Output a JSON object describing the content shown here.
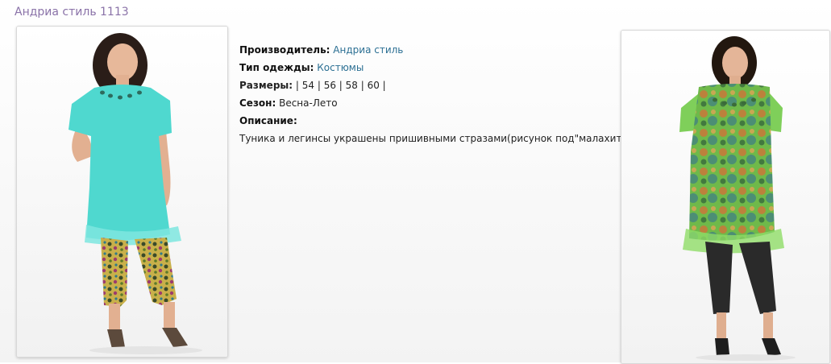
{
  "page": {
    "title": "Андриа стиль 1113"
  },
  "product": {
    "manufacturer": {
      "label": "Производитель:",
      "value": "Андриа стиль"
    },
    "clothing_type": {
      "label": "Тип одежды:",
      "value": "Костюмы"
    },
    "sizes": {
      "label": "Размеры:",
      "value": "| 54 | 56 | 58 | 60 |"
    },
    "season": {
      "label": "Сезон:",
      "value": "Весна-Лето"
    },
    "description": {
      "label": "Описание:",
      "text": "Туника и легинсы украшены пришивными стразами(рисунок под\"малахит\")"
    }
  },
  "colors": {
    "title": "#8a72a8",
    "link": "#2b6f93",
    "tunic_left": "#4fd8cf",
    "tunic_right": "#7fcf5a",
    "leggings_right": "#2a2a2a"
  }
}
